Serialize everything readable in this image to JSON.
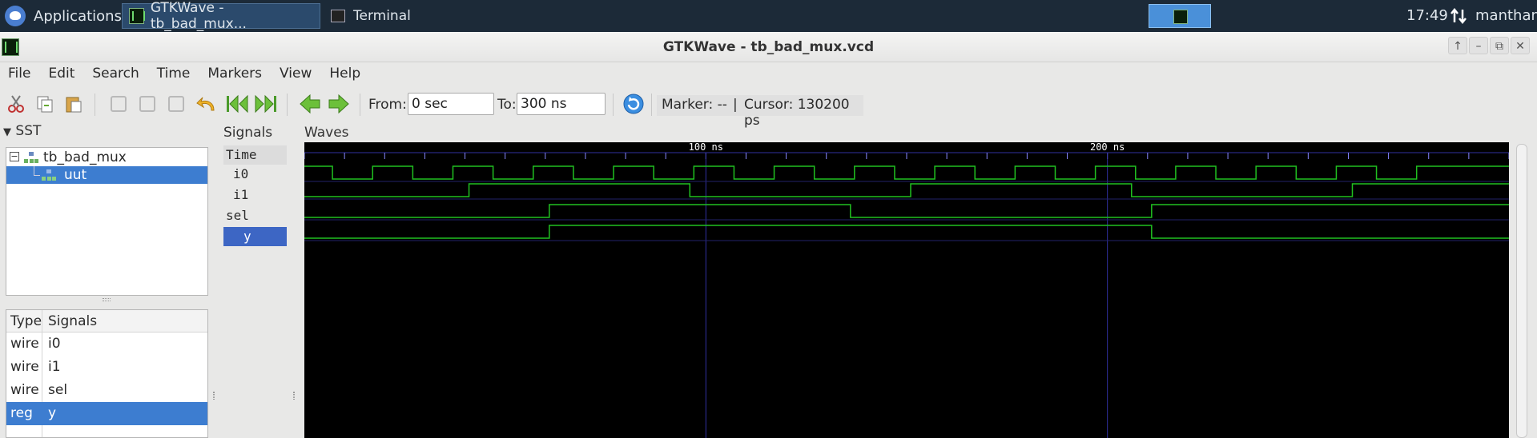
{
  "taskbar": {
    "apps_label": "Applications",
    "tasks": [
      {
        "label": "GTKWave - tb_bad_mux..."
      },
      {
        "label": "Terminal"
      }
    ],
    "clock": "17:49",
    "user": "manthan"
  },
  "window": {
    "title": "GTKWave - tb_bad_mux.vcd"
  },
  "menu": [
    "File",
    "Edit",
    "Search",
    "Time",
    "Markers",
    "View",
    "Help"
  ],
  "toolbar": {
    "from_label": "From:",
    "from_value": "0 sec",
    "to_label": "To:",
    "to_value": "300 ns",
    "marker_text": "Marker: --",
    "divider": "|",
    "cursor_text": "Cursor: 130200 ps"
  },
  "sst": {
    "header": "SST",
    "tree": [
      {
        "label": "tb_bad_mux"
      },
      {
        "label": "uut"
      }
    ],
    "columns": {
      "type": "Type",
      "signals": "Signals"
    },
    "rows": [
      {
        "type": "wire",
        "name": "i0"
      },
      {
        "type": "wire",
        "name": "i1"
      },
      {
        "type": "wire",
        "name": "sel"
      },
      {
        "type": "reg",
        "name": "y"
      }
    ]
  },
  "signals_pane": {
    "header": "Signals",
    "time_label": "Time",
    "names": [
      "i0",
      "i1",
      "sel",
      "y"
    ]
  },
  "waves_pane": {
    "header": "Waves",
    "time_range_ns": [
      0,
      300
    ],
    "axis_ticks": [
      {
        "time_ns": 100,
        "label": "100 ns"
      },
      {
        "time_ns": 200,
        "label": "200 ns"
      }
    ],
    "minor_tick_step_ns": 10,
    "colors": {
      "background": "#000000",
      "wave": "#20c020",
      "grid": "#3030a0",
      "text": "#ffffff"
    },
    "traces": [
      {
        "name": "i0",
        "initial": 1,
        "transitions_ns": [
          7,
          17,
          27,
          37,
          47,
          57,
          67,
          77,
          87,
          97,
          107,
          117,
          127,
          137,
          147,
          157,
          167,
          177,
          187,
          197,
          207,
          217,
          227,
          237,
          247,
          257,
          267,
          277
        ]
      },
      {
        "name": "i1",
        "initial": 0,
        "transitions_ns": [
          41,
          96,
          151,
          206,
          261
        ]
      },
      {
        "name": "sel",
        "initial": 0,
        "transitions_ns": [
          61,
          136,
          211
        ]
      },
      {
        "name": "y",
        "initial": 0,
        "transitions_ns": [
          61,
          211
        ]
      }
    ]
  }
}
